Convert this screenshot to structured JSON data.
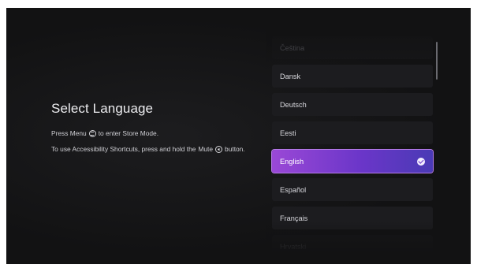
{
  "screen": {
    "title": "Select Language",
    "info": {
      "menu_before": "Press Menu",
      "menu_after": "to enter Store Mode.",
      "access_before": "To use Accessibility Shortcuts, press and hold the",
      "access_mute": "Mute",
      "access_after": "button."
    },
    "icons": {
      "menu": "menu-button-icon",
      "mute": "mute-button-icon",
      "selected": "checkmark-icon"
    }
  },
  "languages": [
    {
      "label": "Čeština",
      "selected": false
    },
    {
      "label": "Dansk",
      "selected": false
    },
    {
      "label": "Deutsch",
      "selected": false
    },
    {
      "label": "Eesti",
      "selected": false
    },
    {
      "label": "English",
      "selected": true
    },
    {
      "label": "Español",
      "selected": false
    },
    {
      "label": "Français",
      "selected": false
    },
    {
      "label": "Hrvatski",
      "selected": false
    }
  ],
  "colors": {
    "background": "#121213",
    "item": "#1c1c1f",
    "selected_gradient_start": "#9a48d6",
    "selected_gradient_end": "#4a3ab5",
    "text": "#d9d9de"
  }
}
